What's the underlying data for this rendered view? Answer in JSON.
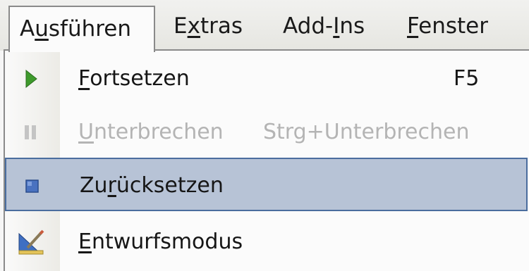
{
  "menubar": {
    "items": [
      {
        "pre": "A",
        "u": "u",
        "post": "sführen",
        "open": true
      },
      {
        "pre": "E",
        "u": "x",
        "post": "tras",
        "open": false
      },
      {
        "pre": "Add-",
        "u": "I",
        "post": "ns",
        "open": false
      },
      {
        "pre": "",
        "u": "F",
        "post": "enster",
        "open": false
      }
    ]
  },
  "dropdown": {
    "items": [
      {
        "pre": "",
        "u": "F",
        "post": "ortsetzen",
        "shortcut": "F5",
        "icon": "play-icon",
        "disabled": false,
        "highlighted": false
      },
      {
        "pre": "",
        "u": "U",
        "post": "nterbrechen",
        "shortcut": "Strg+Unterbrechen",
        "icon": "pause-icon",
        "disabled": true,
        "highlighted": false
      },
      {
        "pre": "Zu",
        "u": "r",
        "post": "ücksetzen",
        "shortcut": "",
        "icon": "stop-icon",
        "disabled": false,
        "highlighted": true
      },
      {
        "pre": "",
        "u": "E",
        "post": "ntwurfsmodus",
        "shortcut": "",
        "icon": "design-mode-icon",
        "disabled": false,
        "highlighted": false
      }
    ]
  },
  "colors": {
    "highlight_bg": "#b7c3d6",
    "highlight_border": "#4a6d9e",
    "disabled_text": "#b4b4b4",
    "play_green": "#3e9a2c",
    "stop_blue": "#4a72c0"
  }
}
